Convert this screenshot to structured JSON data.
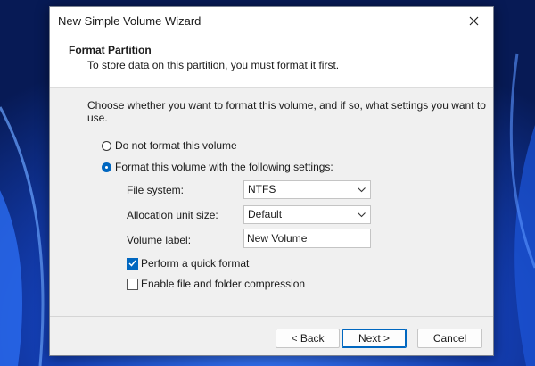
{
  "window": {
    "title": "New Simple Volume Wizard"
  },
  "header": {
    "title": "Format Partition",
    "subtitle": "To store data on this partition, you must format it first."
  },
  "intro": "Choose whether you want to format this volume, and if so, what settings you want to use.",
  "options": {
    "no_format": {
      "label": "Do not format this volume",
      "selected": false
    },
    "format": {
      "label": "Format this volume with the following settings:",
      "selected": true
    }
  },
  "settings": {
    "file_system": {
      "label": "File system:",
      "value": "NTFS"
    },
    "allocation": {
      "label": "Allocation unit size:",
      "value": "Default"
    },
    "volume_label": {
      "label": "Volume label:",
      "value": "New Volume"
    }
  },
  "checkboxes": {
    "quick_format": {
      "label": "Perform a quick format",
      "checked": true
    },
    "compression": {
      "label": "Enable file and folder compression",
      "checked": false
    }
  },
  "buttons": {
    "back": "< Back",
    "next": "Next >",
    "cancel": "Cancel"
  },
  "colors": {
    "accent": "#0067c0",
    "dialog_bg": "#f0f0f0",
    "wallpaper": "#0a1f5c"
  },
  "icons": {
    "close": "close-icon",
    "combo": "chevron-down-icon",
    "check": "checkmark-icon"
  }
}
